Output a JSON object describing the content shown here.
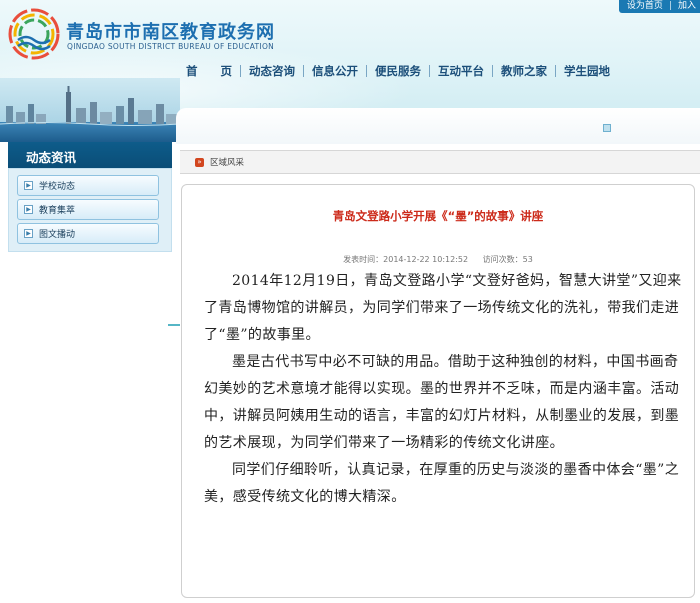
{
  "header": {
    "site_title": "青岛市市南区教育政务网",
    "site_subtitle": "QINGDAO SOUTH DISTRICT BUREAU OF EDUCATION",
    "top_links": [
      "设为首页",
      "加入"
    ]
  },
  "nav": {
    "items": [
      "首　　页",
      "动态咨询",
      "信息公开",
      "便民服务",
      "互动平台",
      "教师之家",
      "学生园地"
    ]
  },
  "sidebar": {
    "title": "动态资讯",
    "items": [
      {
        "label": "学校动态"
      },
      {
        "label": "教育集萃"
      },
      {
        "label": "图文播动"
      }
    ]
  },
  "breadcrumb": {
    "label": "区域风采"
  },
  "article": {
    "title": "青岛文登路小学开展《“墨”的故事》讲座",
    "publish_label": "发表时间：",
    "publish_time": "2014-12-22 10:12:52",
    "visits_label": "访问次数：",
    "visits": "53",
    "paragraphs": [
      "2014年12月19日，青岛文登路小学“文登好爸妈，智慧大讲堂”又迎来了青岛博物馆的讲解员，为同学们带来了一场传统文化的洗礼，带我们走进了“墨”的故事里。",
      "墨是古代书写中必不可缺的用品。借助于这种独创的材料，中国书画奇幻美妙的艺术意境才能得以实现。墨的世界并不乏味，而是内涵丰富。活动中，讲解员阿姨用生动的语言，丰富的幻灯片材料，从制墨业的发展，到墨的艺术展现，为同学们带来了一场精彩的传统文化讲座。",
      "同学们仔细聆听，认真记录，在厚重的历史与淡淡的墨香中体会“墨”之美，感受传统文化的博大精深。"
    ]
  },
  "colors": {
    "brand_blue": "#1d6fb0",
    "title_red": "#cc2a1a",
    "sidebar_dark": "#0e5c8a"
  }
}
